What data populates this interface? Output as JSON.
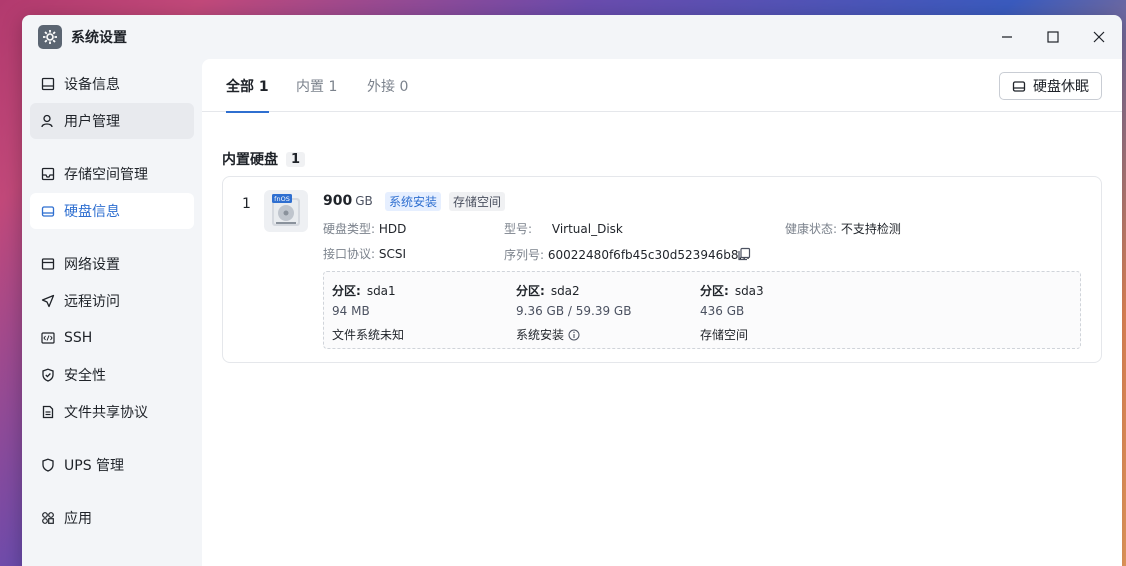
{
  "window": {
    "title": "系统设置"
  },
  "sidebar": {
    "items": [
      {
        "label": "设备信息",
        "icon": "device-icon"
      },
      {
        "label": "用户管理",
        "icon": "user-icon"
      },
      {
        "label": "存储空间管理",
        "icon": "storage-icon"
      },
      {
        "label": "硬盘信息",
        "icon": "disk-icon"
      },
      {
        "label": "网络设置",
        "icon": "network-icon"
      },
      {
        "label": "远程访问",
        "icon": "remote-icon"
      },
      {
        "label": "SSH",
        "icon": "ssh-icon"
      },
      {
        "label": "安全性",
        "icon": "shield-icon"
      },
      {
        "label": "文件共享协议",
        "icon": "file-share-icon"
      },
      {
        "label": "UPS 管理",
        "icon": "ups-icon"
      },
      {
        "label": "应用",
        "icon": "apps-icon"
      }
    ],
    "active": "硬盘信息"
  },
  "tabs": [
    {
      "label": "全部 1"
    },
    {
      "label": "内置 1"
    },
    {
      "label": "外接 0"
    }
  ],
  "toolbar": {
    "sleep_label": "硬盘休眠"
  },
  "section": {
    "title": "内置硬盘",
    "count": "1"
  },
  "disk": {
    "index": "1",
    "icon_label": "fnOS",
    "size": "900",
    "unit": "GB",
    "tags": [
      "系统安装",
      "存储空间"
    ],
    "type_key": "硬盘类型:",
    "type_val": "HDD",
    "model_key": "型号:",
    "model_val": "Virtual_Disk",
    "health_key": "健康状态:",
    "health_val": "不支持检测",
    "iface_key": "接口协议:",
    "iface_val": "SCSI",
    "serial_key": "序列号:",
    "serial_val": "60022480f6fb45c30d523946b8..."
  },
  "partitions": [
    {
      "key": "分区:",
      "name": "sda1",
      "size": "94 MB",
      "fs": "文件系统未知"
    },
    {
      "key": "分区:",
      "name": "sda2",
      "size": "9.36 GB / 59.39 GB",
      "fs": "系统安装"
    },
    {
      "key": "分区:",
      "name": "sda3",
      "size": "436 GB",
      "fs": "存储空间"
    }
  ],
  "colors": {
    "accent": "#2f6fd0",
    "active_bg": "#ffffff",
    "sidebar_bg": "#f3f5f8"
  }
}
